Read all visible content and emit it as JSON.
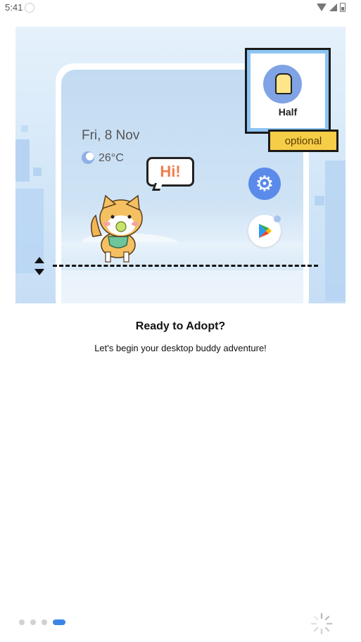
{
  "status_bar": {
    "time": "5:41"
  },
  "illustration": {
    "date": "Fri, 8 Nov",
    "temperature": "26°C",
    "speech_bubble": "Hi!",
    "card_label": "Half",
    "optional_tag": "optional"
  },
  "onboarding": {
    "title": "Ready to Adopt?",
    "subtitle": "Let's begin your desktop buddy adventure!"
  },
  "pager": {
    "total": 4,
    "active_index": 3
  },
  "colors": {
    "accent": "#3b86e4",
    "gear": "#5b8bea",
    "tag": "#f6cd47",
    "hi_text": "#f07c4a"
  },
  "icons": [
    "sync-icon",
    "wifi-icon",
    "signal-icon",
    "battery-icon",
    "weather-icon",
    "gear-icon",
    "play-store-icon",
    "resize-arrows-icon",
    "loading-spinner-icon"
  ]
}
